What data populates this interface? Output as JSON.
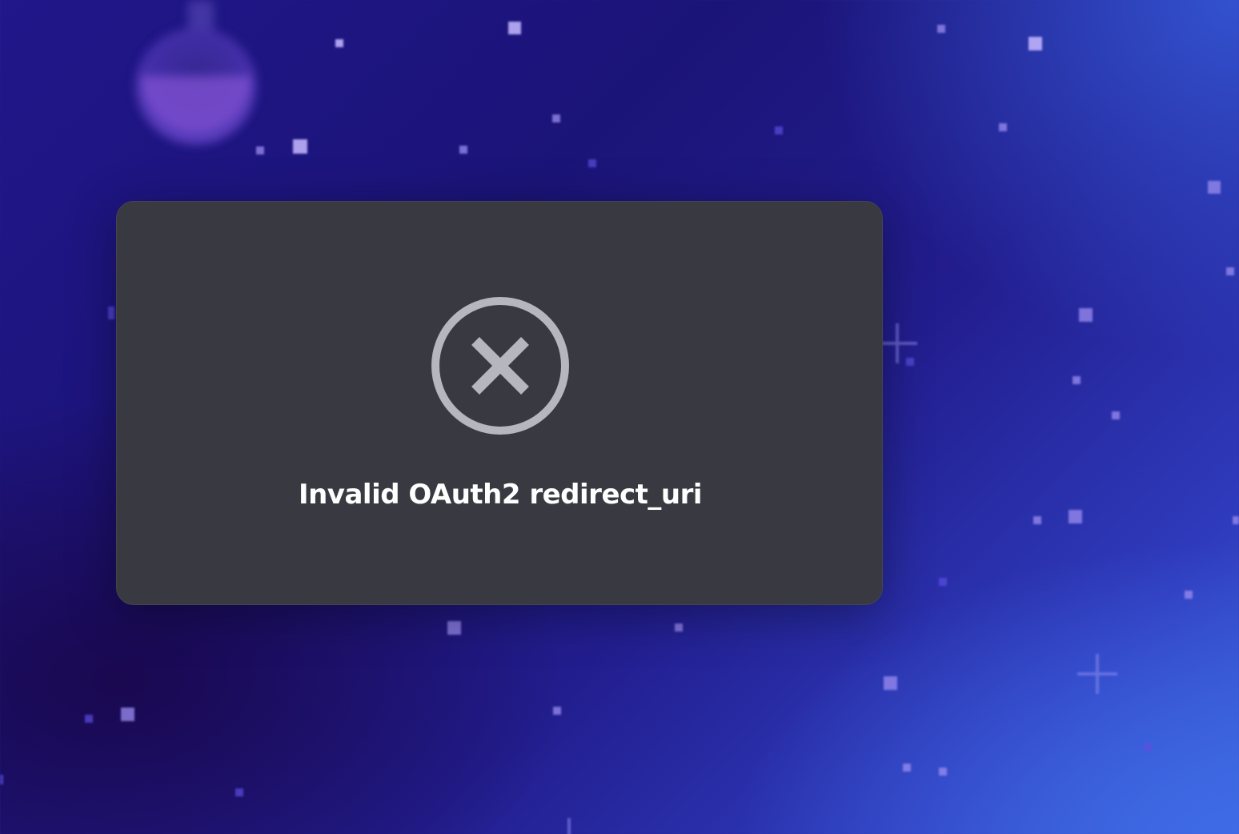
{
  "modal": {
    "icon": "circle-x-icon",
    "message": "Invalid OAuth2 redirect_uri"
  },
  "colors": {
    "modal_background": "#393a41",
    "icon_color": "#b5b6be",
    "message_color": "#ffffff",
    "background_primary": "#1f1788",
    "background_accent": "#3a5fd8"
  },
  "background": {
    "decorations": [
      "flask-illustration",
      "star-field",
      "sparkle-icon"
    ]
  }
}
